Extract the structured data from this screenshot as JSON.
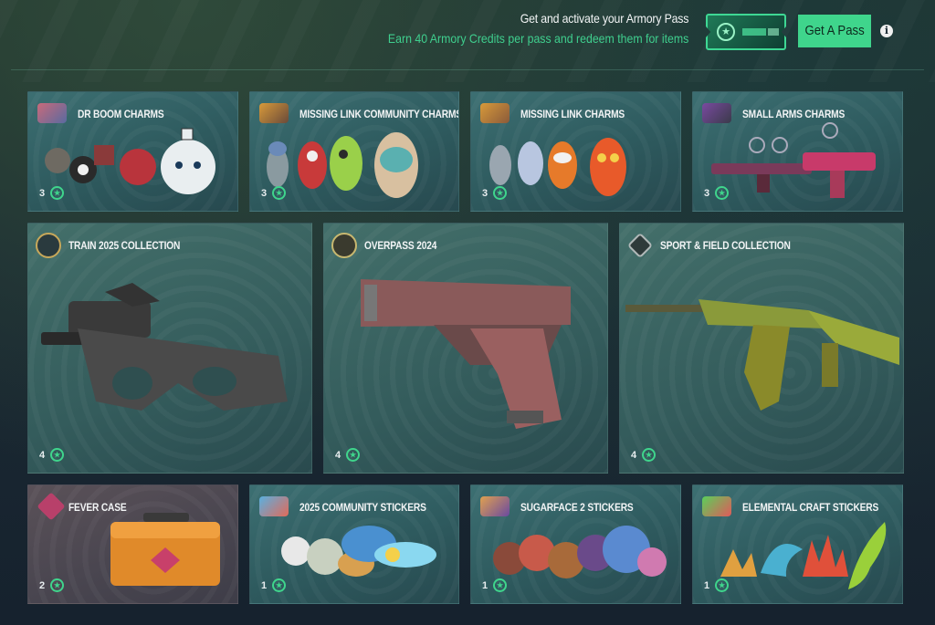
{
  "promo": {
    "title": "Get and activate your Armory Pass",
    "subtitle": "Earn 40 Armory Credits per pass and redeem them for items",
    "button_label": "Get A Pass",
    "info_label": "i",
    "accent": "#3fd58c"
  },
  "rows": {
    "top": [
      {
        "title": "Dr Boom Charms",
        "cost": "3",
        "icon": "charm-icon"
      },
      {
        "title": "Missing Link Community Charms",
        "cost": "3",
        "icon": "charm-icon"
      },
      {
        "title": "Missing Link Charms",
        "cost": "3",
        "icon": "charm-icon"
      },
      {
        "title": "Small Arms Charms",
        "cost": "3",
        "icon": "charm-icon"
      }
    ],
    "middle": [
      {
        "title": "Train 2025 Collection",
        "cost": "4",
        "icon": "collection-emblem-icon"
      },
      {
        "title": "Overpass 2024",
        "cost": "4",
        "icon": "collection-emblem-icon"
      },
      {
        "title": "Sport & Field Collection",
        "cost": "4",
        "icon": "collection-emblem-icon"
      }
    ],
    "bottom": [
      {
        "title": "Fever Case",
        "cost": "2",
        "icon": "case-icon"
      },
      {
        "title": "2025 Community Stickers",
        "cost": "1",
        "icon": "sticker-icon"
      },
      {
        "title": "Sugarface 2 Stickers",
        "cost": "1",
        "icon": "sticker-icon"
      },
      {
        "title": "Elemental Craft Stickers",
        "cost": "1",
        "icon": "sticker-icon"
      }
    ]
  }
}
